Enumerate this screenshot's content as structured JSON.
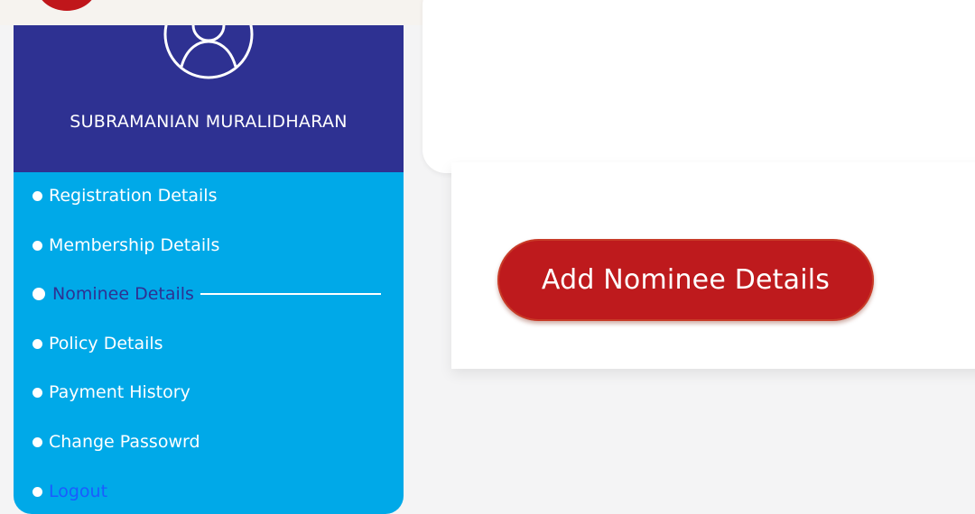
{
  "profile": {
    "name": "SUBRAMANIAN MURALIDHARAN",
    "avatar_icon": "user-icon"
  },
  "menu": {
    "items": [
      {
        "label": "Registration Details",
        "active": false
      },
      {
        "label": "Membership Details",
        "active": false
      },
      {
        "label": "Nominee Details",
        "active": true
      },
      {
        "label": "Policy Details",
        "active": false
      },
      {
        "label": "Payment History",
        "active": false
      },
      {
        "label": "Change Passowrd",
        "active": false
      },
      {
        "label": "Logout",
        "active": false
      }
    ]
  },
  "main": {
    "add_nominee_label": "Add Nominee Details"
  },
  "colors": {
    "sidebar_header": "#2e3192",
    "sidebar_menu": "#00a9e8",
    "button": "#be1a1d",
    "logout_link": "#1a5cff"
  }
}
